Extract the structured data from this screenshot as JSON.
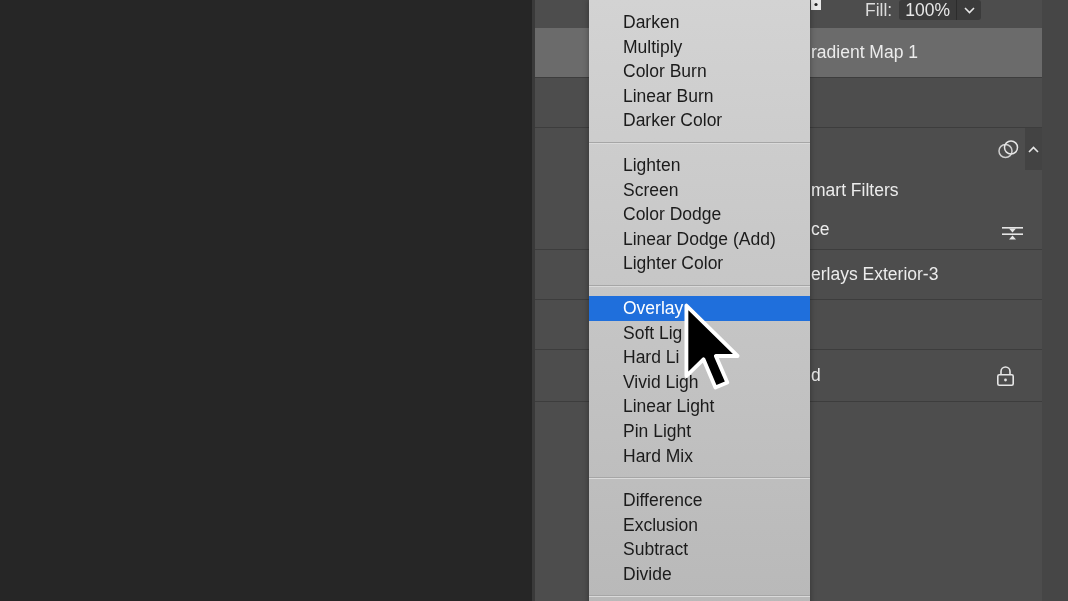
{
  "layers_panel": {
    "fill": {
      "label": "Fill:",
      "value": "100%"
    },
    "layers": [
      {
        "kind": "layer",
        "name": "radient Map 1",
        "selected": true
      },
      {
        "kind": "layer",
        "selected": false
      },
      {
        "kind": "smart-object",
        "selected": false,
        "expanded": true
      },
      {
        "kind": "filter-group",
        "name": "mart Filters",
        "selected": false
      },
      {
        "kind": "filter",
        "name": "ce",
        "selected": false
      },
      {
        "kind": "layer",
        "name": "erlays Exterior-3",
        "selected": false
      },
      {
        "kind": "layer",
        "selected": false
      },
      {
        "kind": "locked-layer",
        "name": "d",
        "selected": false
      }
    ]
  },
  "blend_mode_menu": {
    "groups": [
      {
        "items": [
          {
            "label": "Darken",
            "selected": false
          },
          {
            "label": "Multiply",
            "selected": false
          },
          {
            "label": "Color Burn",
            "selected": false
          },
          {
            "label": "Linear Burn",
            "selected": false
          },
          {
            "label": "Darker Color",
            "selected": false
          }
        ]
      },
      {
        "items": [
          {
            "label": "Lighten",
            "selected": false
          },
          {
            "label": "Screen",
            "selected": false
          },
          {
            "label": "Color Dodge",
            "selected": false
          },
          {
            "label": "Linear Dodge (Add)",
            "selected": false
          },
          {
            "label": "Lighter Color",
            "selected": false
          }
        ]
      },
      {
        "items": [
          {
            "label": "Overlay",
            "selected": true
          },
          {
            "label": "Soft Lig",
            "selected": false
          },
          {
            "label": "Hard Li",
            "selected": false
          },
          {
            "label": "Vivid Ligh",
            "selected": false
          },
          {
            "label": "Linear Light",
            "selected": false
          },
          {
            "label": "Pin Light",
            "selected": false
          },
          {
            "label": "Hard Mix",
            "selected": false
          }
        ]
      },
      {
        "items": [
          {
            "label": "Difference",
            "selected": false
          },
          {
            "label": "Exclusion",
            "selected": false
          },
          {
            "label": "Subtract",
            "selected": false
          },
          {
            "label": "Divide",
            "selected": false
          }
        ]
      }
    ]
  }
}
